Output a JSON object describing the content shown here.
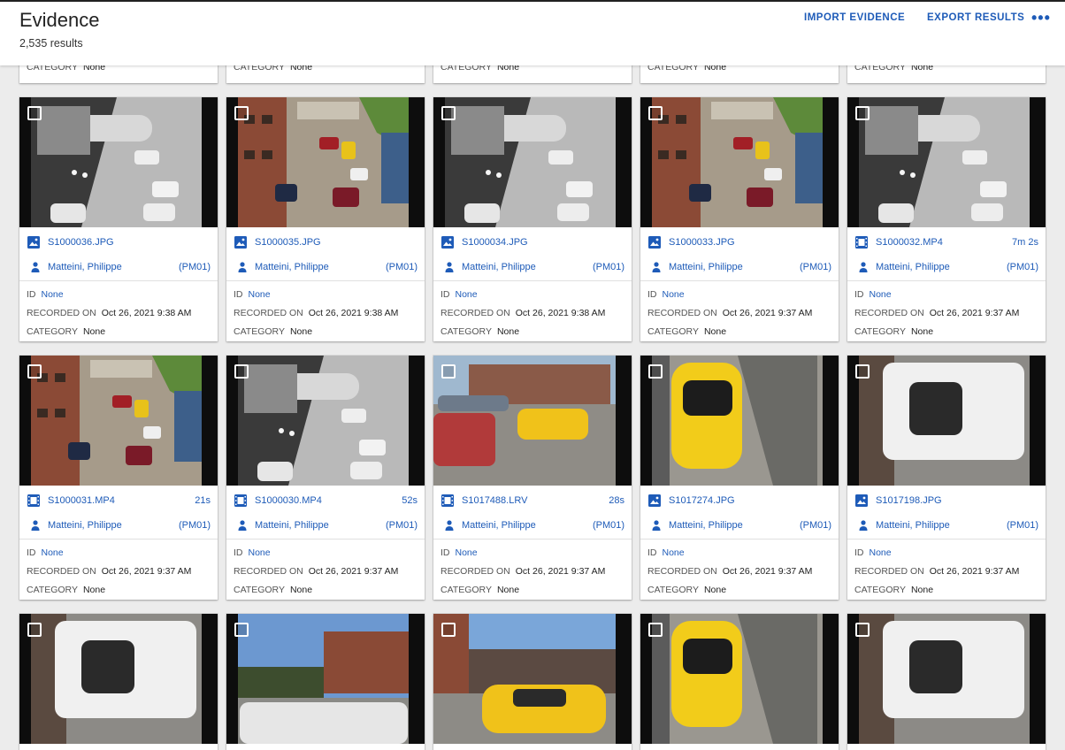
{
  "header": {
    "title": "Evidence",
    "result_count": "2,535 results",
    "import_label": "IMPORT EVIDENCE",
    "export_label": "EXPORT RESULTS",
    "more_label": "•••"
  },
  "labels": {
    "id": "ID",
    "recorded_on": "RECORDED ON",
    "category": "CATEGORY"
  },
  "colors": {
    "link": "#1e5bb8",
    "background": "#ececec"
  },
  "row0": [
    {
      "category": "None"
    },
    {
      "category": "None"
    },
    {
      "category": "None"
    },
    {
      "category": "None"
    },
    {
      "category": "None"
    }
  ],
  "cards": [
    {
      "filename": "S1000036.JPG",
      "type": "image-icon",
      "duration": "",
      "owner": "Matteini, Philippe",
      "owner_code": "(PM01)",
      "id": "None",
      "recorded_on": "Oct 26, 2021 9:38 AM",
      "category": "None",
      "thumb": "thermal-plaza"
    },
    {
      "filename": "S1000035.JPG",
      "type": "image-icon",
      "duration": "",
      "owner": "Matteini, Philippe",
      "owner_code": "(PM01)",
      "id": "None",
      "recorded_on": "Oct 26, 2021 9:38 AM",
      "category": "None",
      "thumb": "color-aerial"
    },
    {
      "filename": "S1000034.JPG",
      "type": "image-icon",
      "duration": "",
      "owner": "Matteini, Philippe",
      "owner_code": "(PM01)",
      "id": "None",
      "recorded_on": "Oct 26, 2021 9:38 AM",
      "category": "None",
      "thumb": "thermal-plaza"
    },
    {
      "filename": "S1000033.JPG",
      "type": "image-icon",
      "duration": "",
      "owner": "Matteini, Philippe",
      "owner_code": "(PM01)",
      "id": "None",
      "recorded_on": "Oct 26, 2021 9:37 AM",
      "category": "None",
      "thumb": "color-aerial"
    },
    {
      "filename": "S1000032.MP4",
      "type": "video-icon",
      "duration": "7m 2s",
      "owner": "Matteini, Philippe",
      "owner_code": "(PM01)",
      "id": "None",
      "recorded_on": "Oct 26, 2021 9:37 AM",
      "category": "None",
      "thumb": "thermal-wide"
    },
    {
      "filename": "S1000031.MP4",
      "type": "video-icon",
      "duration": "21s",
      "owner": "Matteini, Philippe",
      "owner_code": "(PM01)",
      "id": "None",
      "recorded_on": "Oct 26, 2021 9:37 AM",
      "category": "None",
      "thumb": "color-aerial"
    },
    {
      "filename": "S1000030.MP4",
      "type": "video-icon",
      "duration": "52s",
      "owner": "Matteini, Philippe",
      "owner_code": "(PM01)",
      "id": "None",
      "recorded_on": "Oct 26, 2021 9:37 AM",
      "category": "None",
      "thumb": "thermal-wide"
    },
    {
      "filename": "S1017488.LRV",
      "type": "video-icon",
      "duration": "28s",
      "owner": "Matteini, Philippe",
      "owner_code": "(PM01)",
      "id": "None",
      "recorded_on": "Oct 26, 2021 9:37 AM",
      "category": "None",
      "thumb": "crash-scene"
    },
    {
      "filename": "S1017274.JPG",
      "type": "image-icon",
      "duration": "",
      "owner": "Matteini, Philippe",
      "owner_code": "(PM01)",
      "id": "None",
      "recorded_on": "Oct 26, 2021 9:37 AM",
      "category": "None",
      "thumb": "yellow-car-top"
    },
    {
      "filename": "S1017198.JPG",
      "type": "image-icon",
      "duration": "",
      "owner": "Matteini, Philippe",
      "owner_code": "(PM01)",
      "id": "None",
      "recorded_on": "Oct 26, 2021 9:37 AM",
      "category": "None",
      "thumb": "white-van-top"
    }
  ],
  "partial_cards": [
    {
      "thumb": "white-van-top"
    },
    {
      "thumb": "building-trees"
    },
    {
      "thumb": "yellow-car-street"
    },
    {
      "thumb": "yellow-car-top"
    },
    {
      "thumb": "white-van-top"
    }
  ]
}
